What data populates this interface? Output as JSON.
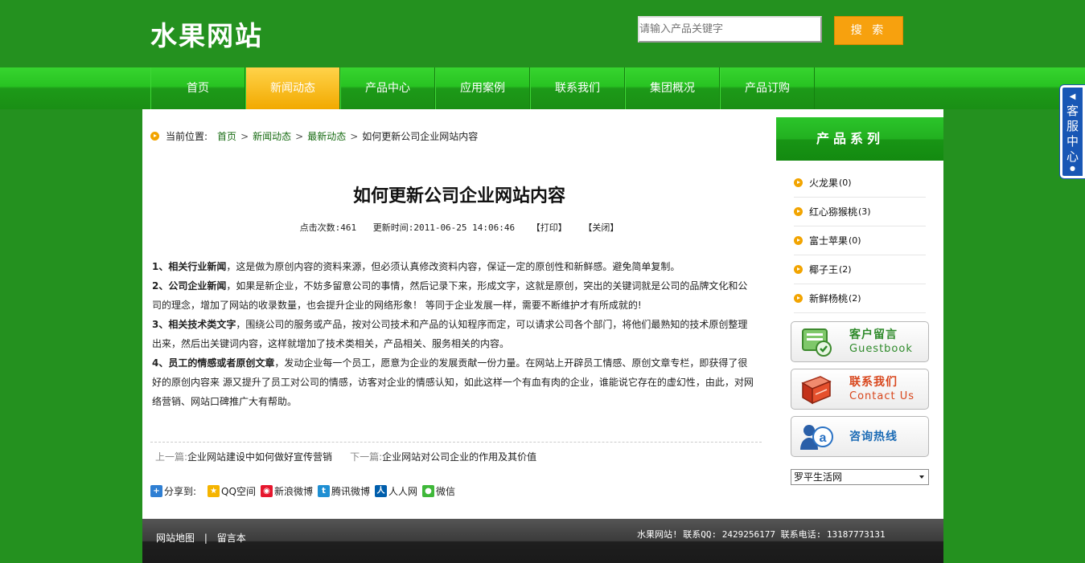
{
  "header": {
    "logo": "水果网站",
    "search_placeholder": "请输入产品关键字",
    "search_button": "搜 索"
  },
  "nav": {
    "items": [
      {
        "label": "首页"
      },
      {
        "label": "新闻动态",
        "active": true
      },
      {
        "label": "产品中心"
      },
      {
        "label": "应用案例"
      },
      {
        "label": "联系我们"
      },
      {
        "label": "集团概况"
      },
      {
        "label": "产品订购"
      }
    ]
  },
  "kefu": {
    "label": "客服中心"
  },
  "breadcrumb": {
    "prefix": "当前位置:",
    "items": [
      "首页",
      "新闻动态",
      "最新动态"
    ],
    "current": "如何更新公司企业网站内容"
  },
  "article": {
    "title": "如何更新公司企业网站内容",
    "clicks_label": "点击次数:461",
    "updated_label": "更新时间:2011-06-25 14:06:46",
    "print_label": "【打印】",
    "close_label": "【关闭】",
    "paragraphs": [
      {
        "head": "1、相关行业新闻",
        "text": "，这是做为原创内容的资料来源，但必须认真修改资料内容，保证一定的原创性和新鲜感。避免简单复制。"
      },
      {
        "head": "2、公司企业新闻",
        "text": "，如果是新企业，不妨多留意公司的事情，然后记录下来，形成文字，这就是原创，突出的关键词就是公司的品牌文化和公司的理念，增加了网站的收录数量，也会提升企业的网络形象！  等同于企业发展一样，需要不断维护才有所成就的!"
      },
      {
        "head": "3、相关技术类文字",
        "text": "，围绕公司的服务或产品，按对公司技术和产品的认知程序而定，可以请求公司各个部门，将他们最熟知的技术原创整理出来，然后出关键词内容，这样就增加了技术类相关，产品相关、服务相关的内容。"
      },
      {
        "head": "4、员工的情感或者原创文章",
        "text": "，发动企业每一个员工，愿意为企业的发展贡献一份力量。在网站上开辟员工情感、原创文章专栏，即获得了很好的原创内容来 源又提升了员工对公司的情感，访客对企业的情感认知，如此这样一个有血有肉的企业，谁能说它存在的虚幻性，由此，对网络营销、网站口碑推广大有帮助。"
      }
    ],
    "prev_label": "上一篇:",
    "prev_title": "企业网站建设中如何做好宣传营销",
    "next_label": "下一篇:",
    "next_title": "企业网站对公司企业的作用及其价值"
  },
  "share": {
    "label": "分享到:",
    "items": [
      {
        "label": "QQ空间",
        "color": "#f5b400"
      },
      {
        "label": "新浪微博",
        "color": "#e6162d"
      },
      {
        "label": "腾讯微博",
        "color": "#1f8fd3"
      },
      {
        "label": "人人网",
        "color": "#005eac"
      },
      {
        "label": "微信",
        "color": "#3fb83a"
      }
    ]
  },
  "sidebar": {
    "title": "产品系列",
    "products": [
      {
        "name": "火龙果",
        "count": "(0)"
      },
      {
        "name": "红心猕猴桃",
        "count": "(3)"
      },
      {
        "name": "富士苹果",
        "count": "(0)"
      },
      {
        "name": "椰子王",
        "count": "(2)"
      },
      {
        "name": "新鲜杨桃 ",
        "count": "(2)"
      }
    ],
    "banners": [
      {
        "title": "客户留言",
        "sub": "Guestbook",
        "color": "#2e8a2a"
      },
      {
        "title": "联系我们",
        "sub": "Contact Us",
        "color": "#d8461c"
      },
      {
        "title": "咨询热线",
        "sub": "",
        "color": "#1b6bb5"
      }
    ],
    "select_value": "罗平生活网"
  },
  "footer": {
    "links": [
      "网站地图",
      "|",
      "留言本"
    ],
    "info": "水果网站! 联系QQ: 2429256177  联系电话: 13187773131"
  },
  "colors": {
    "brand_green": "#24911f",
    "accent_orange": "#f7a10e",
    "link_green": "#176b12"
  }
}
